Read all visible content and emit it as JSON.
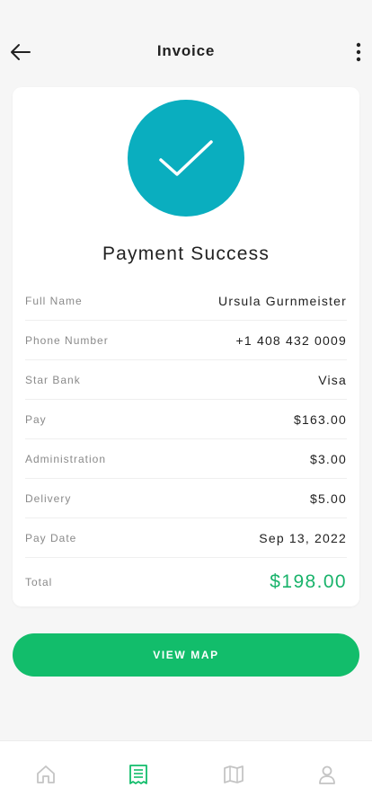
{
  "header": {
    "title": "Invoice",
    "back_icon": "arrow-left-icon",
    "more_icon": "more-vertical-icon"
  },
  "card": {
    "status_icon": "checkmark-icon",
    "title": "Payment Success",
    "rows": [
      {
        "label": "Full Name",
        "value": "Ursula Gurnmeister"
      },
      {
        "label": "Phone Number",
        "value": "+1 408 432 0009"
      },
      {
        "label": "Star Bank",
        "value": "Visa"
      },
      {
        "label": "Pay",
        "value": "$163.00"
      },
      {
        "label": "Administration",
        "value": "$3.00"
      },
      {
        "label": "Delivery",
        "value": "$5.00"
      },
      {
        "label": "Pay Date",
        "value": "Sep 13, 2022"
      }
    ],
    "total": {
      "label": "Total",
      "value": "$198.00"
    }
  },
  "actions": {
    "view_map_label": "VIEW MAP"
  },
  "bottom_nav": [
    {
      "icon": "home-icon",
      "active": false
    },
    {
      "icon": "receipt-icon",
      "active": true
    },
    {
      "icon": "map-icon",
      "active": false
    },
    {
      "icon": "profile-icon",
      "active": false
    }
  ],
  "colors": {
    "accent_teal": "#0aaebf",
    "accent_green": "#12bd6b",
    "total_green": "#19b36b",
    "inactive_icon": "#c4c4c4"
  }
}
